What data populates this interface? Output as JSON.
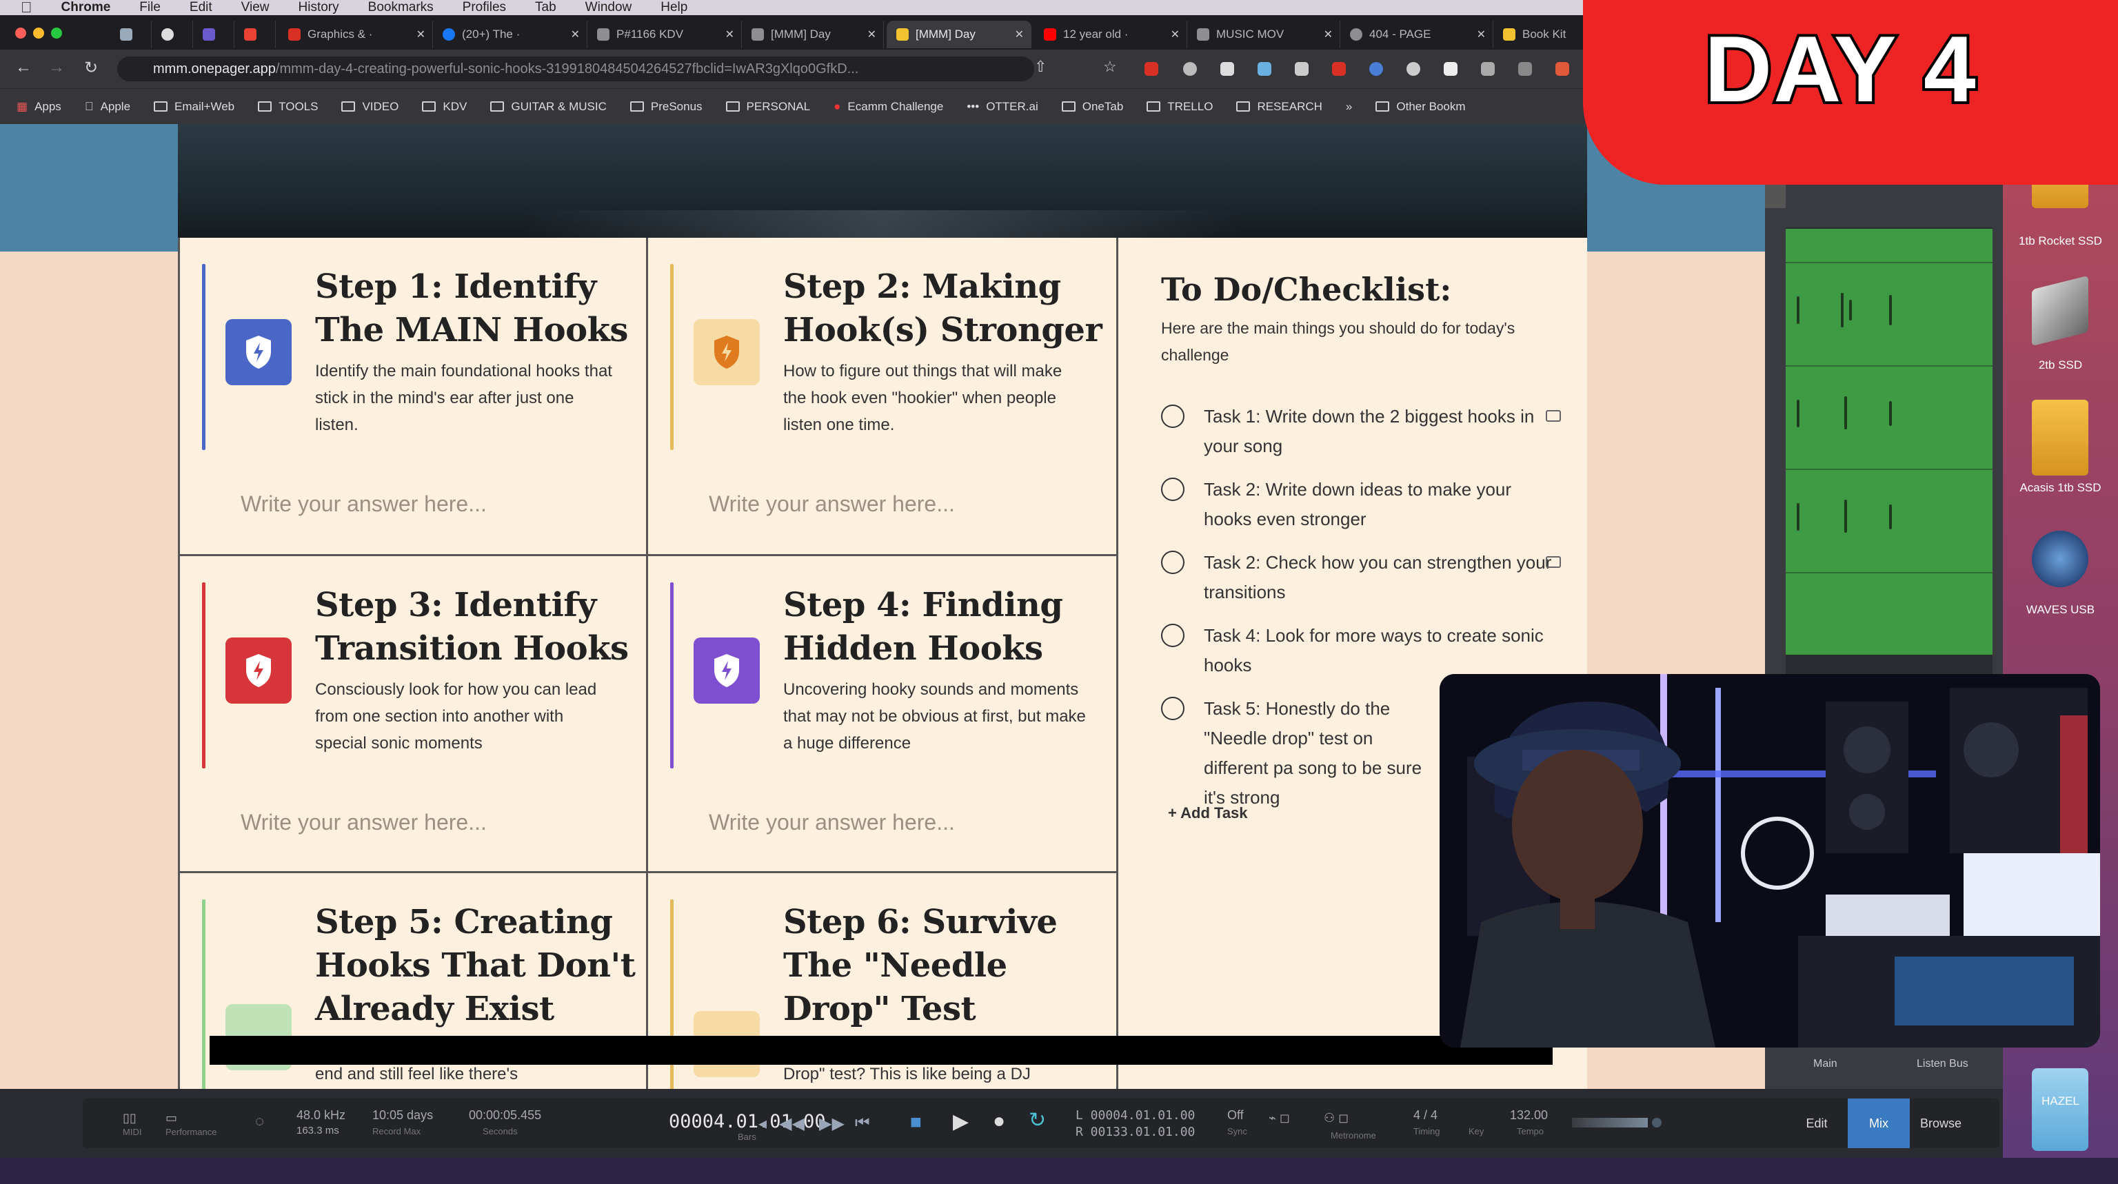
{
  "menubar": {
    "app": "Chrome",
    "items": [
      "File",
      "Edit",
      "View",
      "History",
      "Bookmarks",
      "Profiles",
      "Tab",
      "Window",
      "Help"
    ]
  },
  "browser": {
    "tabs": [
      {
        "label": "Graphics & ·",
        "color": "#d93025"
      },
      {
        "label": "(20+) The ·",
        "color": "#1877f2"
      },
      {
        "label": "P#1166 KDV",
        "color": "#8d8d92"
      },
      {
        "label": "[MMM] Day",
        "color": "#8d8d92"
      },
      {
        "label": "[MMM] Day",
        "color": "#f2c230",
        "active": true
      },
      {
        "label": "12 year old ·",
        "color": "#ff0000"
      },
      {
        "label": "MUSIC MOV",
        "color": "#8d8d92"
      },
      {
        "label": "404 - PAGE",
        "color": "#8d8d92"
      },
      {
        "label": "Book Kit",
        "color": "#f2c230"
      }
    ],
    "url_main": "mmm.onepager.app",
    "url_rest": "/mmm-day-4-creating-powerful-sonic-hooks-3199180484504264527fbclid=IwAR3gXlqo0GfkD...",
    "bookmarks": [
      "Apps",
      "Apple",
      "Email+Web",
      "TOOLS",
      "VIDEO",
      "KDV",
      "GUITAR & MUSIC",
      "PreSonus",
      "PERSONAL",
      "Ecamm Challenge",
      "OTTER.ai",
      "OneTab",
      "TRELLO",
      "RESEARCH",
      "»",
      "Other Bookm"
    ]
  },
  "steps": [
    {
      "title": "Step 1: Identify The MAIN Hooks",
      "desc": "Identify the main foundational hooks that stick in the mind's ear after just one listen.",
      "placeholder": "Write your answer here...",
      "color": "#4a67c8",
      "accent": "#4a67c8"
    },
    {
      "title": "Step 2: Making Hook(s) Stronger",
      "desc": "How to figure out things that will make the hook even \"hookier\" when people listen one time.",
      "placeholder": "Write your answer here...",
      "color": "#f6dba4",
      "accent": "#e4bb5a"
    },
    {
      "title": "Step 3: Identify Transition Hooks",
      "desc": "Consciously look for how you can lead from one section into another with special sonic moments",
      "placeholder": "Write your answer here...",
      "color": "#d6363a",
      "accent": "#d6363a"
    },
    {
      "title": "Step 4: Finding Hidden Hooks",
      "desc": "Uncovering hooky sounds and moments that may not be obvious at first, but make a huge difference",
      "placeholder": "Write your answer here...",
      "color": "#7e4fd0",
      "accent": "#7e4fd0"
    },
    {
      "title": "Step 5: Creating Hooks That Don't Already Exist",
      "desc": "end and still feel like there's",
      "color": "#bfe3b7",
      "accent": "#8fd08a"
    },
    {
      "title": "Step 6: Survive The \"Needle Drop\" Test",
      "desc": "Drop\" test? This is like being a DJ",
      "color": "#f6dba4",
      "accent": "#e4bb5a"
    }
  ],
  "checklist": {
    "title": "To Do/Checklist:",
    "subtitle": "Here are the main things you should do for today's challenge",
    "tasks": [
      {
        "text": "Task 1: Write down the 2 biggest hooks in your song",
        "comment": true
      },
      {
        "text": "Task 2: Write down ideas to make your hooks even stronger",
        "comment": false
      },
      {
        "text": "Task 2: Check how you can strengthen your transitions",
        "comment": true
      },
      {
        "text": "Task 4: Look for more ways to create sonic hooks",
        "comment": false
      },
      {
        "text": "Task 5: Honestly do the \"Needle drop\" test on different pa song to be sure it's strong",
        "comment": false
      }
    ],
    "add_task": "+ Add Task"
  },
  "banner": {
    "text": "DAY 4"
  },
  "daw": {
    "midi": "MIDI",
    "performance": "Performance",
    "sample_rate": "48.0 kHz",
    "latency": "163.3 ms",
    "days": "10:05 days",
    "record_max": "Record Max",
    "seconds_value": "00:00:05.455",
    "seconds": "Seconds",
    "position": "00004.01.01.00",
    "bars": "Bars",
    "loop_l": "L  00004.01.01.00",
    "loop_r": "R  00133.01.01.00",
    "off": "Off",
    "sync": "Sync",
    "metronome": "Metronome",
    "signature": "4 / 4",
    "timing": "Timing",
    "key": "Key",
    "tempo_value": "132.00",
    "tempo": "Tempo",
    "tabs": [
      "Edit",
      "Mix",
      "Browse"
    ],
    "bus_labels": [
      "Main",
      "Listen Bus"
    ]
  },
  "dock": {
    "items": [
      {
        "label": "1tb Rocket SSD"
      },
      {
        "label": "2tb SSD"
      },
      {
        "label": "Acasis 1tb SSD"
      },
      {
        "label": "WAVES USB"
      },
      {
        "label": "HAZEL"
      }
    ]
  }
}
